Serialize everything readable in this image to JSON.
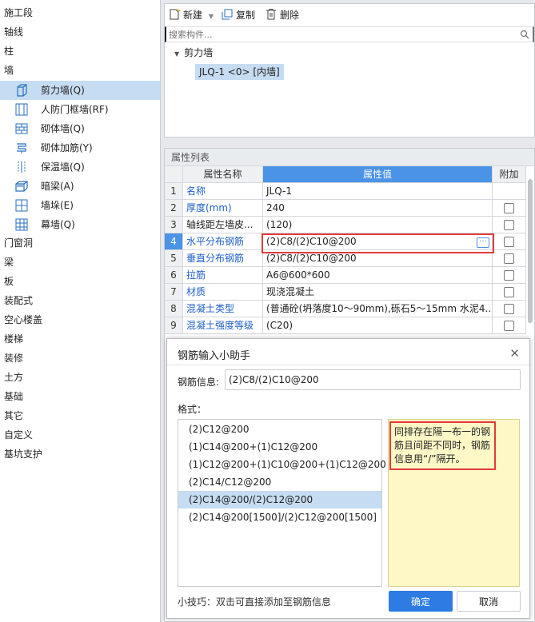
{
  "sidebar": {
    "categories": [
      "施工段",
      "轴线",
      "柱",
      "墙"
    ],
    "wall_items": [
      {
        "label": "剪力墙(Q)",
        "icon": "shear-wall-icon"
      },
      {
        "label": "人防门框墙(RF)",
        "icon": "civil-defense-door-wall-icon"
      },
      {
        "label": "砌体墙(Q)",
        "icon": "masonry-wall-icon"
      },
      {
        "label": "砌体加筋(Y)",
        "icon": "masonry-reinforcement-icon"
      },
      {
        "label": "保温墙(Q)",
        "icon": "insulation-wall-icon"
      },
      {
        "label": "暗梁(A)",
        "icon": "hidden-beam-icon"
      },
      {
        "label": "墙垛(E)",
        "icon": "wall-pier-icon"
      },
      {
        "label": "幕墙(Q)",
        "icon": "curtain-wall-icon"
      }
    ],
    "more_categories": [
      "门窗洞",
      "梁",
      "板",
      "装配式",
      "空心楼盖",
      "楼梯",
      "装修",
      "土方",
      "基础",
      "其它",
      "自定义",
      "基坑支护"
    ]
  },
  "toolbar": {
    "new_label": "新建",
    "copy_label": "复制",
    "delete_label": "删除"
  },
  "search": {
    "placeholder": "搜索构件..."
  },
  "tree": {
    "root_label": "剪力墙",
    "item_label": "JLQ-1 <0> [内墙]"
  },
  "properties": {
    "title": "属性列表",
    "headers": {
      "name": "属性名称",
      "value": "属性值",
      "add": "附加"
    },
    "rows": [
      {
        "no": "1",
        "name": "名称",
        "value": "JLQ-1",
        "link": true,
        "checkbox": false
      },
      {
        "no": "2",
        "name": "厚度(mm)",
        "value": "240",
        "link": true,
        "checkbox": true
      },
      {
        "no": "3",
        "name": "轴线距左墙皮...",
        "value": "(120)",
        "link": false,
        "checkbox": true
      },
      {
        "no": "4",
        "name": "水平分布钢筋",
        "value": "(2)C8/(2)C10@200",
        "link": true,
        "checkbox": true
      },
      {
        "no": "5",
        "name": "垂直分布钢筋",
        "value": "(2)C8/(2)C10@200",
        "link": true,
        "checkbox": true
      },
      {
        "no": "6",
        "name": "拉筋",
        "value": "A6@600*600",
        "link": true,
        "checkbox": true
      },
      {
        "no": "7",
        "name": "材质",
        "value": "现浇混凝土",
        "link": true,
        "checkbox": true
      },
      {
        "no": "8",
        "name": "混凝土类型",
        "value": "(普通砼(坍落度10～90mm),砾石5～15mm 水泥4...",
        "link": true,
        "checkbox": true
      },
      {
        "no": "9",
        "name": "混凝土强度等级",
        "value": "(C20)",
        "link": true,
        "checkbox": true
      }
    ]
  },
  "dialog": {
    "title": "钢筋输入小助手",
    "info_label": "钢筋信息:",
    "info_value": "(2)C8/(2)C10@200",
    "format_label": "格式：",
    "formats": [
      "(2)C12@200",
      "(1)C14@200+(1)C12@200",
      "(1)C12@200+(1)C10@200+(1)C12@200",
      "(2)C14/C12@200",
      "(2)C14@200/(2)C12@200",
      "(2)C14@200[1500]/(2)C12@200[1500]"
    ],
    "selected_format_index": 4,
    "hint": "同排存在隔一布一的钢筋且间距不同时，钢筋信息用“/”隔开。",
    "tip": "小技巧：双击可直接添加至钢筋信息",
    "ok_label": "确定",
    "cancel_label": "取消"
  },
  "colors": {
    "accent": "#2d7be3",
    "selection": "#c6dcf2",
    "highlight_border": "#e23b3b",
    "hint_bg": "#fdf8c6"
  }
}
